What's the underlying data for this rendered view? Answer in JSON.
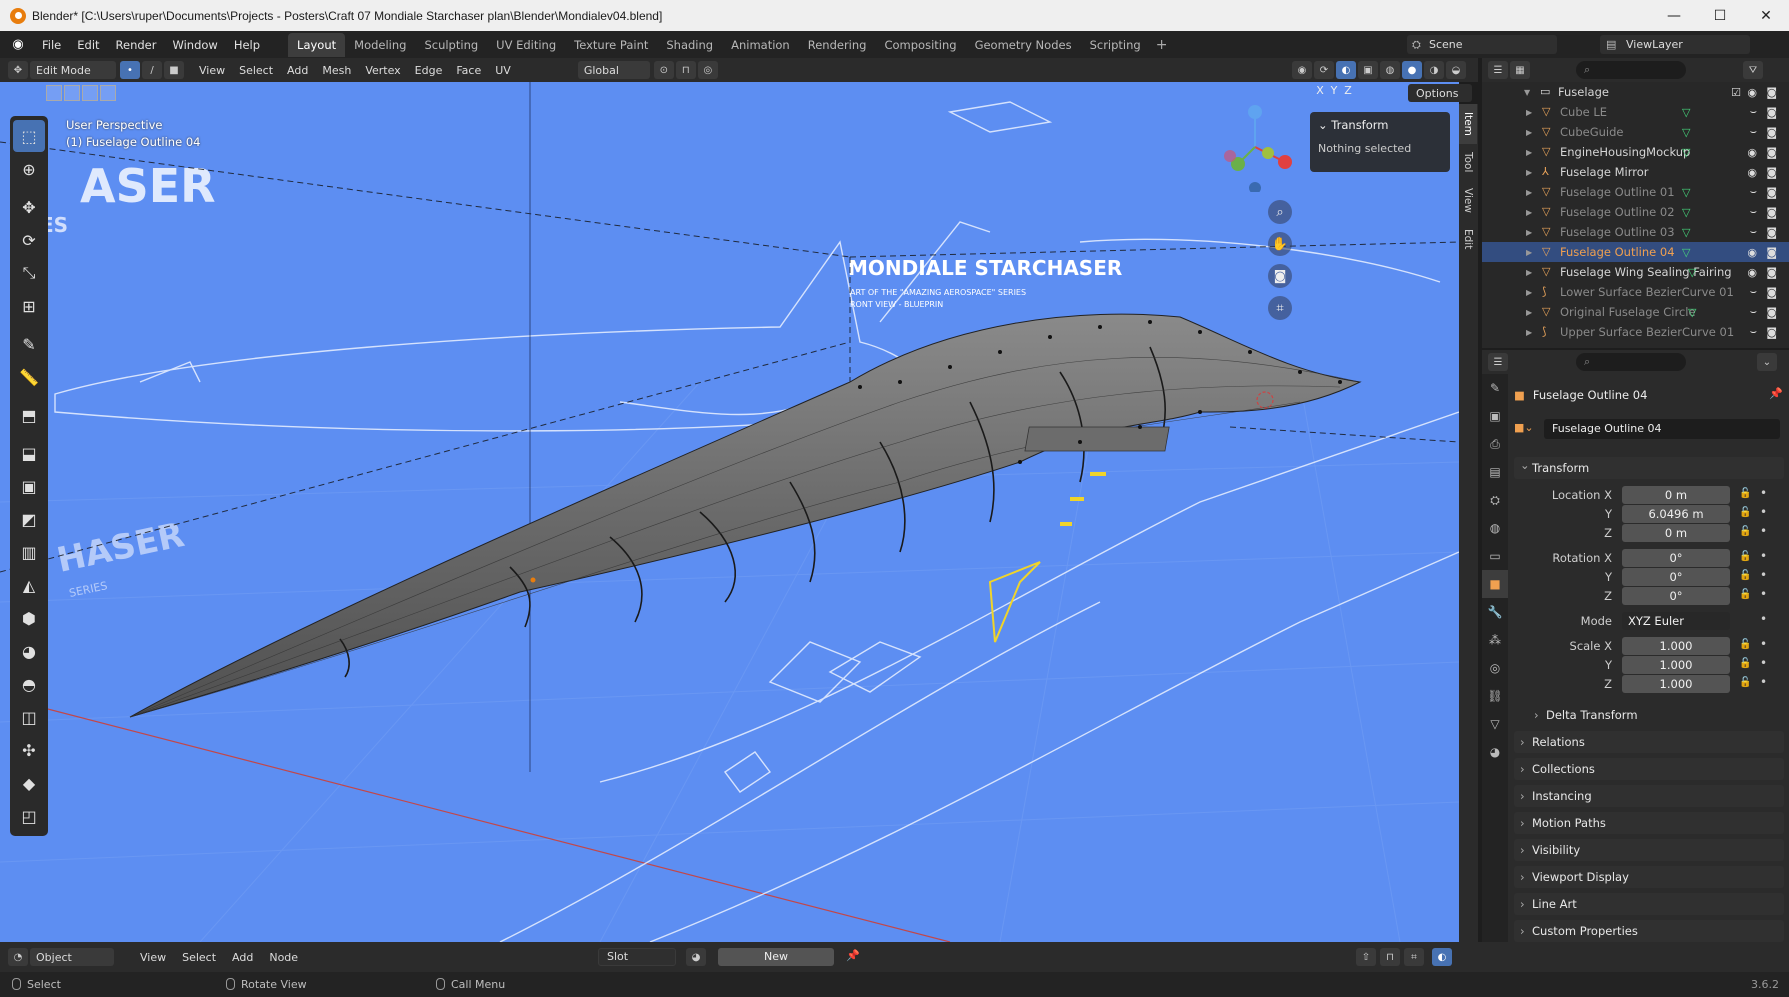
{
  "window": {
    "title": "Blender* [C:\\Users\\ruper\\Documents\\Projects - Posters\\Craft 07 Mondiale Starchaser plan\\Blender\\Mondialev04.blend]"
  },
  "menu": [
    "File",
    "Edit",
    "Render",
    "Window",
    "Help"
  ],
  "workspaces": [
    {
      "label": "Layout",
      "active": true
    },
    {
      "label": "Modeling"
    },
    {
      "label": "Sculpting"
    },
    {
      "label": "UV Editing"
    },
    {
      "label": "Texture Paint"
    },
    {
      "label": "Shading"
    },
    {
      "label": "Animation"
    },
    {
      "label": "Rendering"
    },
    {
      "label": "Compositing"
    },
    {
      "label": "Geometry Nodes"
    },
    {
      "label": "Scripting"
    }
  ],
  "scene": {
    "name": "Scene"
  },
  "view_layer": {
    "name": "ViewLayer"
  },
  "viewport_header": {
    "mode": "Edit Mode",
    "menus": [
      "View",
      "Select",
      "Add",
      "Mesh",
      "Vertex",
      "Edge",
      "Face",
      "UV"
    ],
    "orientation": "Global",
    "axes": [
      "X",
      "Y",
      "Z"
    ],
    "options_label": "Options"
  },
  "viewport": {
    "perspective": "User Perspective",
    "object_label": "(1) Fuselage Outline 04",
    "background_color": "#5d8ef2",
    "blueprint_texts": {
      "big_title": "ASER",
      "sub_title": "ES",
      "lower_title": "HASER",
      "lower_sub": "SERIES",
      "main_title": "MONDIALE STARCHASER",
      "tag1": "ART OF THE \"AMAZING AEROSPACE\" SERIES",
      "tag2": "RONT VIEW - BLUEPRIN"
    }
  },
  "n_panel": {
    "tabs": [
      "Item",
      "Tool",
      "View",
      "Edit"
    ],
    "section": "Transform",
    "message": "Nothing selected"
  },
  "outliner": {
    "collection": "Fuselage",
    "items": [
      {
        "label": "Cube LE",
        "dim": true,
        "type": "mesh"
      },
      {
        "label": "CubeGuide",
        "dim": true,
        "type": "mesh"
      },
      {
        "label": "EngineHousingMockup",
        "dim": false,
        "type": "mesh"
      },
      {
        "label": "Fuselage Mirror",
        "dim": false,
        "type": "empty"
      },
      {
        "label": "Fuselage Outline 01",
        "dim": true,
        "type": "mesh"
      },
      {
        "label": "Fuselage Outline 02",
        "dim": true,
        "type": "mesh"
      },
      {
        "label": "Fuselage Outline 03",
        "dim": true,
        "type": "mesh"
      },
      {
        "label": "Fuselage Outline 04",
        "dim": false,
        "type": "mesh",
        "selected": true
      },
      {
        "label": "Fuselage Wing Sealing Fairing",
        "dim": false,
        "type": "mesh"
      },
      {
        "label": "Lower Surface BezierCurve 01",
        "dim": true,
        "type": "curve"
      },
      {
        "label": "Original Fuselage Circle",
        "dim": true,
        "type": "mesh"
      },
      {
        "label": "Upper Surface BezierCurve 01",
        "dim": true,
        "type": "curve"
      }
    ]
  },
  "properties": {
    "object_name": "Fuselage Outline 04",
    "name_field": "Fuselage Outline 04",
    "transform_title": "Transform",
    "location": {
      "label": "Location X",
      "x": "0 m",
      "y": "6.0496 m",
      "z": "0 m"
    },
    "rotation": {
      "label": "Rotation X",
      "x": "0°",
      "y": "0°",
      "z": "0°"
    },
    "mode": {
      "label": "Mode",
      "value": "XYZ Euler"
    },
    "scale": {
      "label": "Scale X",
      "x": "1.000",
      "y": "1.000",
      "z": "1.000"
    },
    "axis_y": "Y",
    "axis_z": "Z",
    "delta": "Delta Transform",
    "panels": [
      "Relations",
      "Collections",
      "Instancing",
      "Motion Paths",
      "Visibility",
      "Viewport Display",
      "Line Art",
      "Custom Properties"
    ]
  },
  "shader_header": {
    "object_mode": "Object",
    "menus": [
      "View",
      "Select",
      "Add",
      "Node"
    ],
    "slot": "Slot",
    "new_label": "New"
  },
  "status": {
    "select": "Select",
    "rotate": "Rotate View",
    "call_menu": "Call Menu",
    "version": "3.6.2"
  }
}
